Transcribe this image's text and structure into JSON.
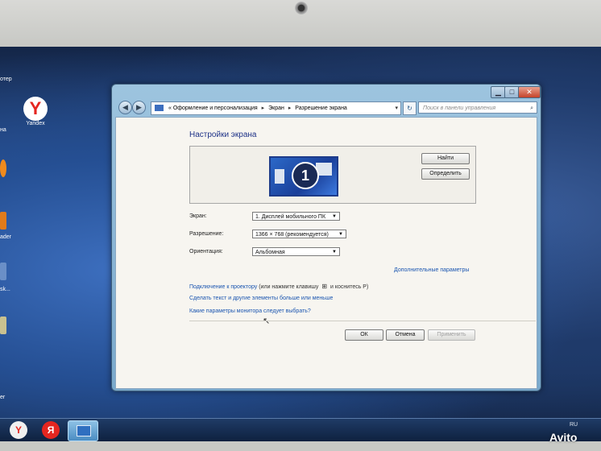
{
  "desktop": {
    "icons": [
      {
        "label": "Yandex"
      }
    ],
    "edge_labels": [
      "отер",
      "на",
      "ader",
      "sk...",
      "er"
    ]
  },
  "window": {
    "controls": {
      "minimize": "▁",
      "maximize": "□",
      "close": "✕"
    },
    "nav": {
      "back": "◀",
      "forward": "▶"
    },
    "address": {
      "prefix": "«",
      "crumbs": [
        "Оформление и персонализация",
        "Экран",
        "Разрешение экрана"
      ],
      "separator": "▸",
      "dropdown": "▾"
    },
    "refresh": "↻",
    "search": {
      "placeholder": "Поиск в панели управления",
      "icon": "search-icon"
    },
    "heading": "Настройки экрана",
    "monitor_number": "1",
    "buttons": {
      "find": "Найти",
      "identify": "Определить",
      "ok": "ОК",
      "cancel": "Отмена",
      "apply": "Применить"
    },
    "fields": {
      "screen_label": "Экран:",
      "screen_value": "1. Дисплей мобильного ПК",
      "resolution_label": "Разрешение:",
      "resolution_value": "1366 × 768 (рекомендуется)",
      "orientation_label": "Ориентация:",
      "orientation_value": "Альбомная"
    },
    "links": {
      "advanced": "Дополнительные параметры",
      "projector": "Подключение к проектору",
      "projector_hint_1": " (или нажмите клавишу ",
      "projector_hint_2": " и коснитесь P)",
      "bigger_text": "Сделать текст и другие элементы больше или меньше",
      "which_monitor": "Какие параметры монитора следует выбрать?"
    }
  },
  "taskbar": {
    "lang": "RU",
    "icons": [
      "Y",
      "Я"
    ]
  },
  "watermark": "Avito",
  "colors": {
    "link": "#1a55b0",
    "heading": "#1e3287",
    "close_button": "#c4432a"
  }
}
